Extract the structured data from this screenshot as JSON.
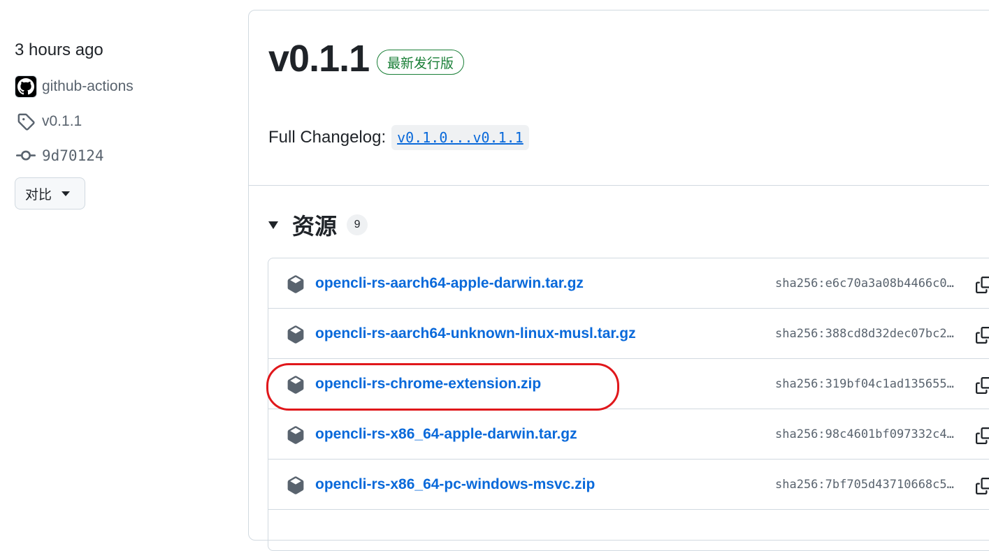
{
  "sidebar": {
    "time": "3 hours ago",
    "author": "github-actions",
    "tag": "v0.1.1",
    "commit": "9d70124",
    "compare_label": "对比"
  },
  "release": {
    "title": "v0.1.1",
    "badge": "最新发行版",
    "changelog_label": "Full Changelog:",
    "changelog_link": "v0.1.0...v0.1.1"
  },
  "assets": {
    "label": "资源",
    "count": "9",
    "items": [
      {
        "name": "opencli-rs-aarch64-apple-darwin.tar.gz",
        "sha": "sha256:e6c70a3a08b4466c0…"
      },
      {
        "name": "opencli-rs-aarch64-unknown-linux-musl.tar.gz",
        "sha": "sha256:388cd8d32dec07bc2…"
      },
      {
        "name": "opencli-rs-chrome-extension.zip",
        "sha": "sha256:319bf04c1ad135655…"
      },
      {
        "name": "opencli-rs-x86_64-apple-darwin.tar.gz",
        "sha": "sha256:98c4601bf097332c4…"
      },
      {
        "name": "opencli-rs-x86_64-pc-windows-msvc.zip",
        "sha": "sha256:7bf705d43710668c5…"
      }
    ]
  },
  "colors": {
    "link": "#0969da",
    "badge_green": "#1a7f37",
    "highlight_red": "#e0171b",
    "border": "#d1d9e0"
  }
}
